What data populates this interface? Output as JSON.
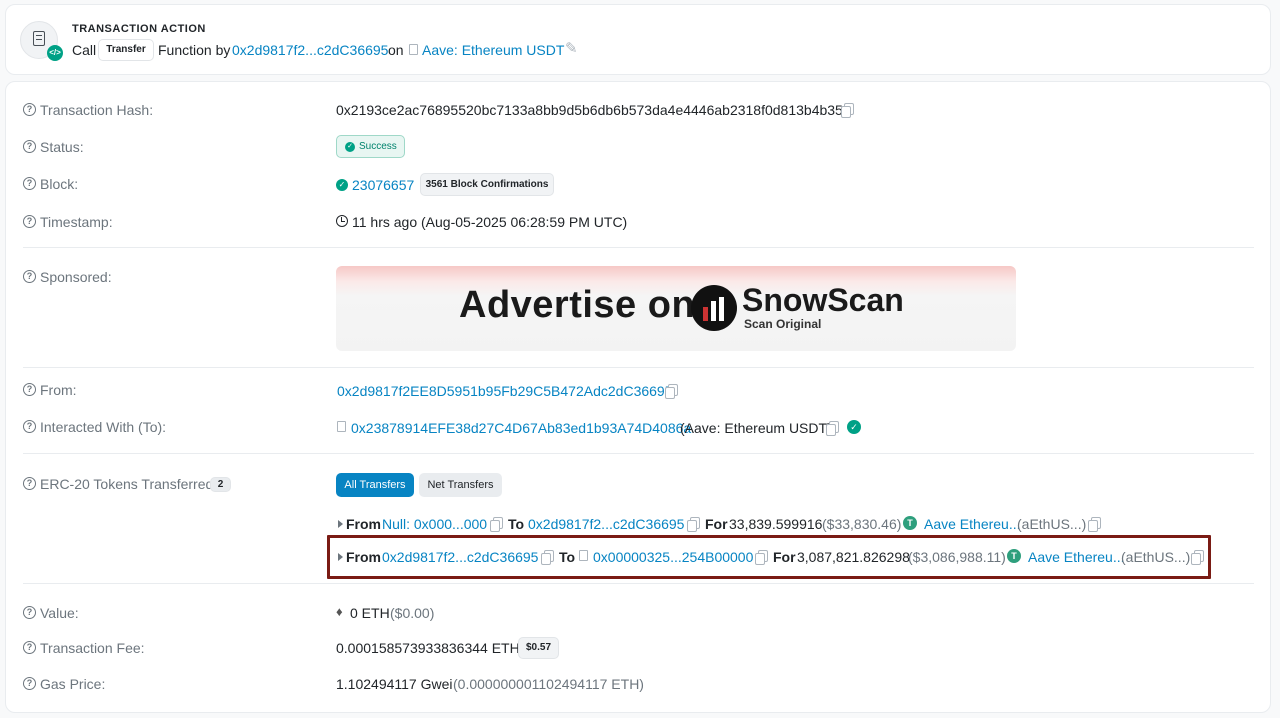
{
  "tx_action": {
    "title": "TRANSACTION ACTION",
    "call": "Call",
    "method_badge": "Transfer",
    "function_by": "Function by",
    "from_address": "0x2d9817f2...c2dC36695",
    "on": "on",
    "contract_name": "Aave: Ethereum USDT"
  },
  "rows": {
    "tx_hash": {
      "label": "Transaction Hash:",
      "value": "0x2193ce2ac76895520bc7133a8bb9d5b6db6b573da4e4446ab2318f0d813b4b35"
    },
    "status": {
      "label": "Status:",
      "value": "Success"
    },
    "block": {
      "label": "Block:",
      "value": "23076657",
      "confirmations": "3561 Block Confirmations"
    },
    "timestamp": {
      "label": "Timestamp:",
      "value": "11 hrs ago (Aug-05-2025 06:28:59 PM UTC)"
    },
    "sponsored": {
      "label": "Sponsored:"
    },
    "from": {
      "label": "From:",
      "value": "0x2d9817f2EE8D5951b95Fb29C5B472Adc2dC36695"
    },
    "to": {
      "label": "Interacted With (To):",
      "value": "0x23878914EFE38d27C4D67Ab83ed1b93A74D4086a",
      "name": "(Aave: Ethereum USDT)"
    },
    "erc20": {
      "label": "ERC-20 Tokens Transferred:",
      "count": "2",
      "tabs": [
        "All Transfers",
        "Net Transfers"
      ],
      "transfers": [
        {
          "from_label": "From",
          "from": "Null: 0x000...000",
          "to_label": "To",
          "to": "0x2d9817f2...c2dC36695",
          "for_label": "For",
          "amount": "33,839.599916",
          "usd": "($33,830.46)",
          "token": "Aave Ethereu...",
          "symbol": "(aEthUS...)"
        },
        {
          "from_label": "From",
          "from": "0x2d9817f2...c2dC36695",
          "to_label": "To",
          "to": "0x00000325...254B00000",
          "for_label": "For",
          "amount": "3,087,821.826298",
          "usd": "($3,086,988.11)",
          "token": "Aave Ethereu...",
          "symbol": "(aEthUS...)"
        }
      ]
    },
    "value": {
      "label": "Value:",
      "amount": "0 ETH",
      "usd": "($0.00)"
    },
    "fee": {
      "label": "Transaction Fee:",
      "value": "0.000158573933836344 ETH",
      "usd": "$0.57"
    },
    "gas": {
      "label": "Gas Price:",
      "value": "1.102494117 Gwei",
      "eth": "(0.000000001102494117 ETH)"
    }
  },
  "ad": {
    "text": "Advertise on",
    "brand": "SnowScan",
    "tagline": "Scan Original"
  },
  "colors": {
    "link": "#0784c3",
    "success": "#00a186",
    "highlight": "#7a1b14",
    "tab_active": "#0784c3"
  }
}
